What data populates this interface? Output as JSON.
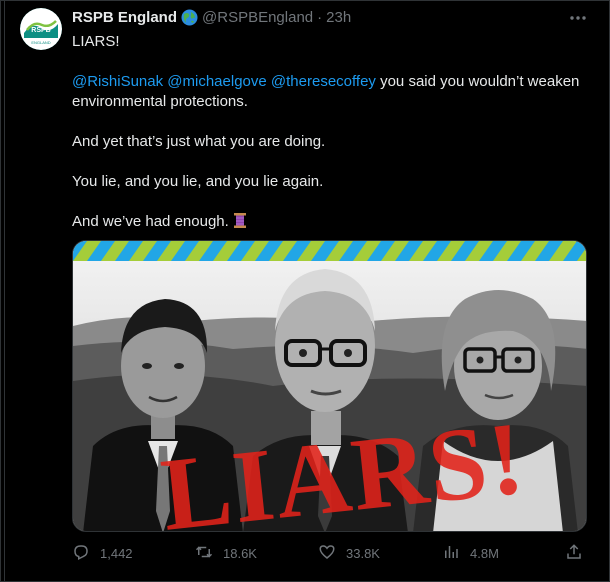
{
  "tweet": {
    "display_name": "RSPB England",
    "handle": "@RSPBEngland",
    "separator": "·",
    "time": "23h",
    "avatar_logo_text": "RSPB",
    "avatar_sub_text": "ENGLAND",
    "lines": {
      "p1": "LIARS!",
      "mention1": "@RishiSunak",
      "mention2": "@michaelgove",
      "mention3": "@theresecoffey",
      "p2_rest": " you said you wouldn’t weaken environmental protections.",
      "p3": "And yet that’s just what you are doing.",
      "p4": "You lie, and you lie, and you lie again.",
      "p5": "And we’ve had enough."
    },
    "media": {
      "overlay_text": "LIARS!"
    },
    "actions": {
      "replies": "1,442",
      "retweets": "18.6K",
      "likes": "33.8K",
      "views": "4.8M"
    },
    "colors": {
      "accent": "#1d9bf0",
      "muted": "#71767b",
      "overlay_red": "#e2231a",
      "stripe_blue": "#22a6e6",
      "stripe_green": "#a5cd39"
    },
    "icons": [
      "globe-icon",
      "more-icon",
      "spool-icon",
      "reply-icon",
      "retweet-icon",
      "like-icon",
      "views-icon",
      "share-icon"
    ]
  }
}
